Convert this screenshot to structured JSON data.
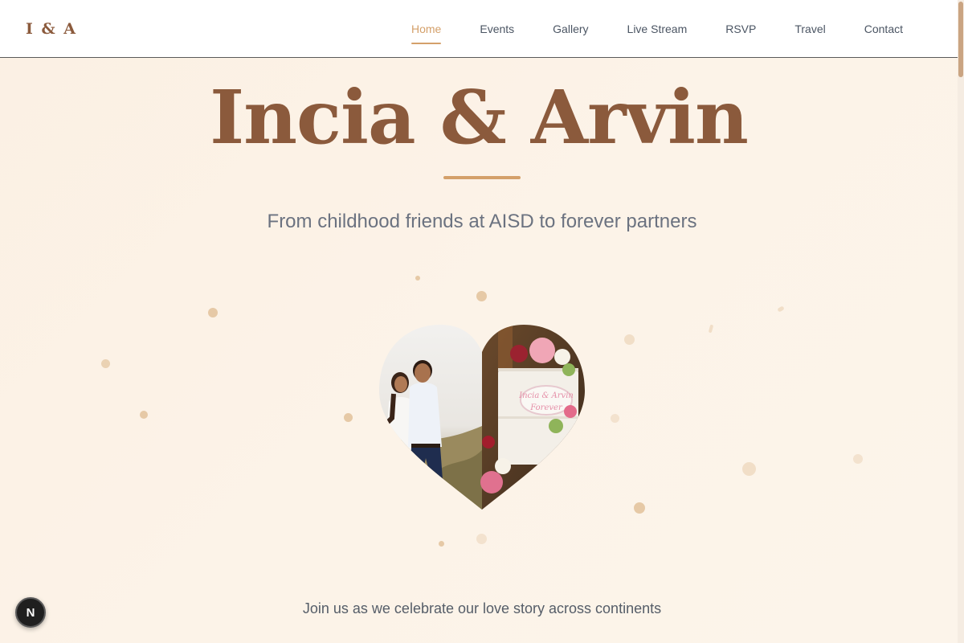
{
  "brand": {
    "logo": "I & A"
  },
  "nav": {
    "items": [
      {
        "label": "Home",
        "active": true
      },
      {
        "label": "Events"
      },
      {
        "label": "Gallery"
      },
      {
        "label": "Live Stream"
      },
      {
        "label": "RSVP"
      },
      {
        "label": "Travel"
      },
      {
        "label": "Contact"
      }
    ]
  },
  "hero": {
    "title": "Incia & Arvin",
    "subtitle": "From childhood friends at AISD to forever partners"
  },
  "photo": {
    "cake_text_line1": "Incia & Arvin",
    "cake_text_line2": "Forever"
  },
  "tagline": "Join us as we celebrate our love story across continents",
  "dev_badge": {
    "label": "N"
  },
  "colors": {
    "accent": "#d4a06a",
    "brown": "#8b5a3c",
    "text_muted": "#6b7280",
    "background": "#fbf0e3"
  }
}
